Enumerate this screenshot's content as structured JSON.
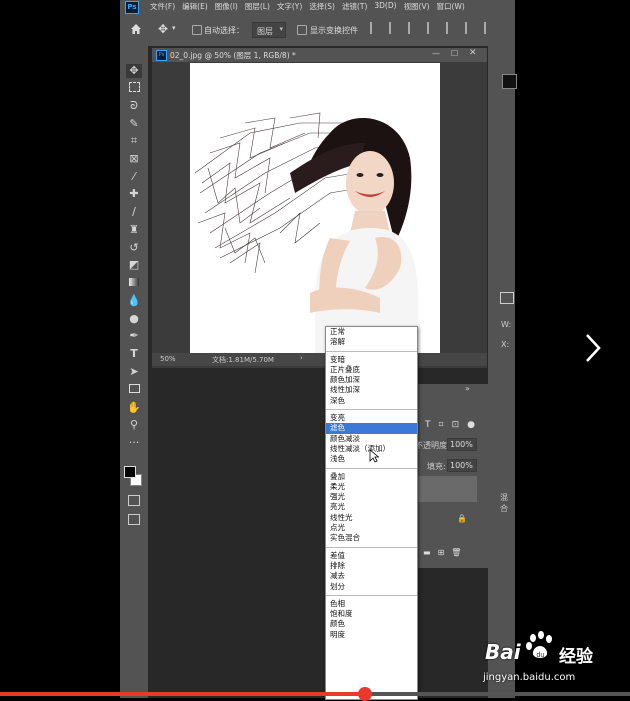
{
  "menubar": {
    "logo": "Ps",
    "items": [
      "文件(F)",
      "编辑(E)",
      "图像(I)",
      "图层(L)",
      "文字(Y)",
      "选择(S)",
      "滤镜(T)",
      "3D(D)",
      "视图(V)",
      "窗口(W)"
    ]
  },
  "options_bar": {
    "auto_select_label": "自动选择：",
    "auto_select_value": "图层",
    "show_transform_label": "显示变换控件"
  },
  "document": {
    "tab_title": "02_0.jpg @ 50% (图层 1, RGB/8) *",
    "zoom": "50%",
    "doc_size": "文档:1.81M/5.70M"
  },
  "layers_panel": {
    "opacity_label": "不透明度:",
    "opacity_value": "100%",
    "fill_label": "填充:",
    "fill_value": "100%"
  },
  "right_panel": {
    "w_label": "W:",
    "x_label": "X:",
    "side_label": "混合"
  },
  "blend_modes": {
    "groups": [
      [
        "正常",
        "溶解"
      ],
      [
        "变暗",
        "正片叠底",
        "颜色加深",
        "线性加深",
        "深色"
      ],
      [
        "变亮",
        "滤色",
        "颜色减淡",
        "线性减淡（添加）",
        "浅色"
      ],
      [
        "叠加",
        "柔光",
        "强光",
        "亮光",
        "线性光",
        "点光",
        "实色混合"
      ],
      [
        "差值",
        "排除",
        "减去",
        "划分"
      ],
      [
        "色相",
        "饱和度",
        "颜色",
        "明度"
      ]
    ],
    "selected": "滤色"
  },
  "watermark": {
    "brand_left": "Bai",
    "brand_right": "经验",
    "url": "jingyan.baidu.com"
  },
  "colors": {
    "accent": "#3c78d8",
    "panel": "#535353",
    "workspace": "#282828",
    "progress": "#e8392b"
  },
  "progress": {
    "fraction": 0.58
  }
}
